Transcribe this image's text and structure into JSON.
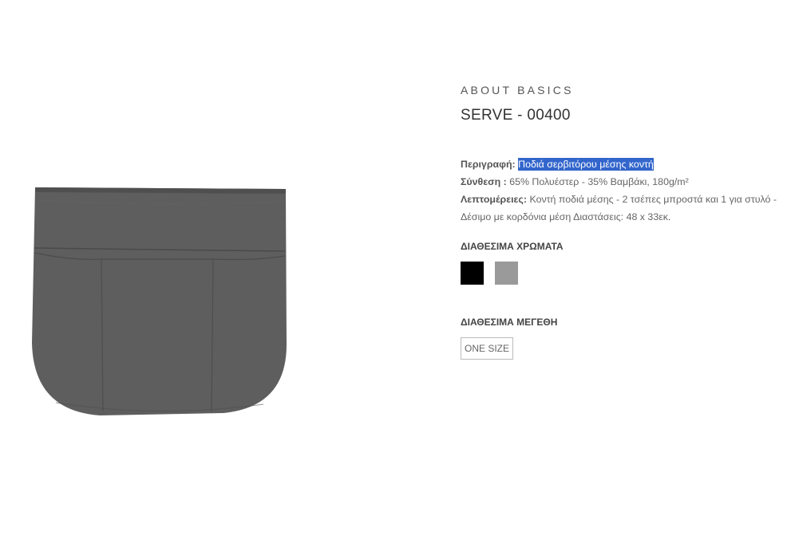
{
  "product": {
    "brand": "ABOUT BASICS",
    "title": "SERVE - 00400",
    "description_label": "Περιγραφή:",
    "description_value": "Ποδιά σερβιτόρου μέσης κοντή",
    "composition_label": "Σύνθεση :",
    "composition_value": "65% Πολυέστερ - 35% Βαμβάκι, 180g/m²",
    "details_label": "Λεπτομέρειες:",
    "details_value": "Κοντή ποδιά μέσης - 2 τσέπες μπροστά και 1 για στυλό - Δέσιμο με κορδόνια μέση Διαστάσεις: 48 x 33εκ."
  },
  "colors": {
    "label": "ΔΙΑΘΕΣΙΜΑ ΧΡΩΜΑΤΑ",
    "swatches": [
      {
        "name": "black",
        "hex": "#000000"
      },
      {
        "name": "grey",
        "hex": "#9a9a9a"
      }
    ]
  },
  "sizes": {
    "label": "ΔΙΑΘΕΣΙΜΑ ΜΕΓΕΘΗ",
    "options": [
      "ONE SIZE"
    ]
  },
  "theme": {
    "apron_color": "#5e5e5e",
    "highlight_color": "#3366cc"
  }
}
